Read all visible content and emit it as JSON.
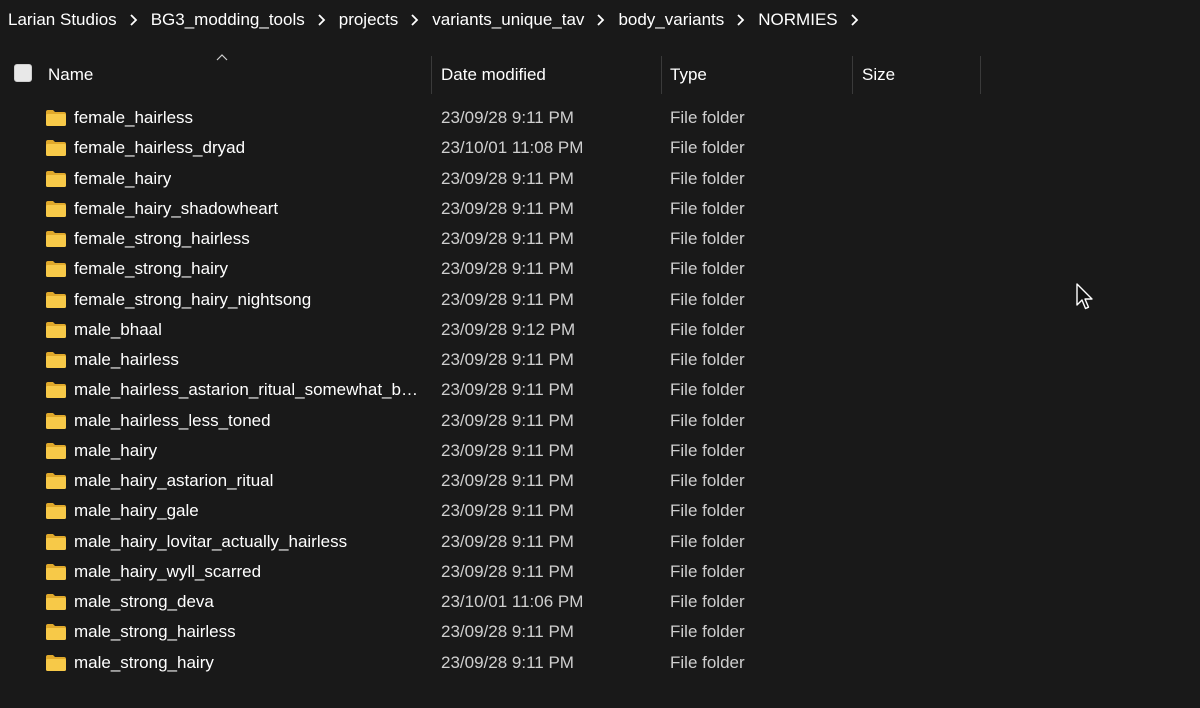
{
  "breadcrumb": {
    "items": [
      "Larian Studios",
      "BG3_modding_tools",
      "projects",
      "variants_unique_tav",
      "body_variants",
      "NORMIES"
    ]
  },
  "columns": {
    "name": "Name",
    "date": "Date modified",
    "type": "Type",
    "size": "Size"
  },
  "colors": {
    "background": "#191919",
    "text": "#ffffff",
    "secondary_text": "#cfcfcf",
    "folder": "#f4c542"
  },
  "icons": {
    "row_icon": "folder-icon",
    "sort": "sort-ascending-icon",
    "separator": "chevron-right-icon",
    "pointer": "mouse-cursor-icon"
  },
  "files": [
    {
      "name": "female_hairless",
      "date": "23/09/28 9:11 PM",
      "type": "File folder"
    },
    {
      "name": "female_hairless_dryad",
      "date": "23/10/01 11:08 PM",
      "type": "File folder"
    },
    {
      "name": "female_hairy",
      "date": "23/09/28 9:11 PM",
      "type": "File folder"
    },
    {
      "name": "female_hairy_shadowheart",
      "date": "23/09/28 9:11 PM",
      "type": "File folder"
    },
    {
      "name": "female_strong_hairless",
      "date": "23/09/28 9:11 PM",
      "type": "File folder"
    },
    {
      "name": "female_strong_hairy",
      "date": "23/09/28 9:11 PM",
      "type": "File folder"
    },
    {
      "name": "female_strong_hairy_nightsong",
      "date": "23/09/28 9:11 PM",
      "type": "File folder"
    },
    {
      "name": "male_bhaal",
      "date": "23/09/28 9:12 PM",
      "type": "File folder"
    },
    {
      "name": "male_hairless",
      "date": "23/09/28 9:11 PM",
      "type": "File folder"
    },
    {
      "name": "male_hairless_astarion_ritual_somewhat_brok...",
      "date": "23/09/28 9:11 PM",
      "type": "File folder"
    },
    {
      "name": "male_hairless_less_toned",
      "date": "23/09/28 9:11 PM",
      "type": "File folder"
    },
    {
      "name": "male_hairy",
      "date": "23/09/28 9:11 PM",
      "type": "File folder"
    },
    {
      "name": "male_hairy_astarion_ritual",
      "date": "23/09/28 9:11 PM",
      "type": "File folder"
    },
    {
      "name": "male_hairy_gale",
      "date": "23/09/28 9:11 PM",
      "type": "File folder"
    },
    {
      "name": "male_hairy_lovitar_actually_hairless",
      "date": "23/09/28 9:11 PM",
      "type": "File folder"
    },
    {
      "name": "male_hairy_wyll_scarred",
      "date": "23/09/28 9:11 PM",
      "type": "File folder"
    },
    {
      "name": "male_strong_deva",
      "date": "23/10/01 11:06 PM",
      "type": "File folder"
    },
    {
      "name": "male_strong_hairless",
      "date": "23/09/28 9:11 PM",
      "type": "File folder"
    },
    {
      "name": "male_strong_hairy",
      "date": "23/09/28 9:11 PM",
      "type": "File folder"
    }
  ]
}
